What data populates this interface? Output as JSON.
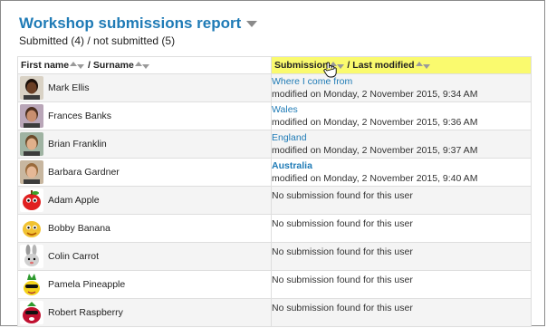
{
  "report": {
    "title": "Workshop submissions report",
    "summary": "Submitted (4) / not submitted (5)"
  },
  "columns": {
    "first_name": "First name",
    "separator": " / ",
    "surname": "Surname",
    "submission": "Submission",
    "last_modified": "Last modified"
  },
  "rows": [
    {
      "name": "Mark Ellis",
      "avatar": "photo-avatar",
      "submission": "Where I come from",
      "bold": false,
      "modified": "modified on Monday, 2 November 2015, 9:34 AM"
    },
    {
      "name": "Frances Banks",
      "avatar": "photo-avatar",
      "submission": "Wales",
      "bold": false,
      "modified": "modified on Monday, 2 November 2015, 9:36 AM"
    },
    {
      "name": "Brian Franklin",
      "avatar": "photo-avatar",
      "submission": "England",
      "bold": false,
      "modified": "modified on Monday, 2 November 2015, 9:37 AM"
    },
    {
      "name": "Barbara Gardner",
      "avatar": "photo-avatar",
      "submission": "Australia",
      "bold": true,
      "modified": "modified on Monday, 2 November 2015, 9:40 AM"
    },
    {
      "name": "Adam Apple",
      "avatar": "apple-avatar",
      "submission": "",
      "nosub": "No submission found for this user"
    },
    {
      "name": "Bobby Banana",
      "avatar": "banana-avatar",
      "submission": "",
      "nosub": "No submission found for this user"
    },
    {
      "name": "Colin Carrot",
      "avatar": "carrot-avatar",
      "submission": "",
      "nosub": "No submission found for this user"
    },
    {
      "name": "Pamela Pineapple",
      "avatar": "pineapple-avatar",
      "submission": "",
      "nosub": "No submission found for this user"
    },
    {
      "name": "Robert Raspberry",
      "avatar": "raspberry-avatar",
      "submission": "",
      "nosub": "No submission found for this user"
    }
  ],
  "colors": {
    "link": "#1f7bb6",
    "highlight": "#fafa6e",
    "row_stripe": "#f4f4f4"
  },
  "icons": [
    "caret-down-icon",
    "sort-arrows-icon",
    "hand-cursor-icon"
  ]
}
